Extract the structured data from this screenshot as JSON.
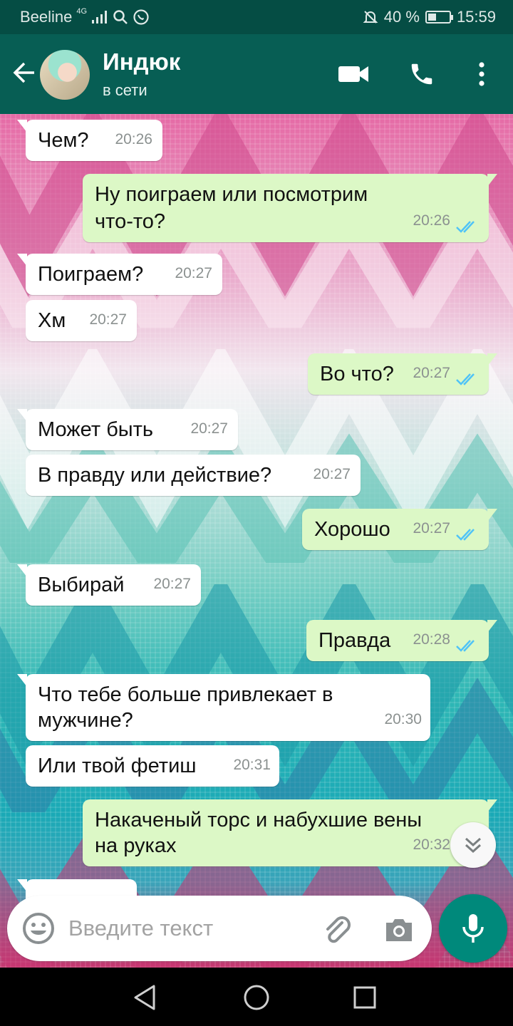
{
  "status_bar": {
    "carrier": "Beeline",
    "network": "4G",
    "battery_percent": "40 %",
    "battery_level": 0.4,
    "time": "15:59"
  },
  "header": {
    "contact_name": "Индюк",
    "contact_status": "в сети",
    "icons": [
      "back-arrow-icon",
      "video-call-icon",
      "phone-icon",
      "more-vertical-icon"
    ]
  },
  "messages": [
    {
      "dir": "in",
      "text": "Чем?",
      "time": "20:26"
    },
    {
      "dir": "out",
      "lines": [
        "Ну поиграем или посмотрим",
        "что-то?"
      ],
      "time": "20:26"
    },
    {
      "dir": "in",
      "text": "Поиграем?",
      "time": "20:27"
    },
    {
      "dir": "in",
      "text": "Хм",
      "time": "20:27"
    },
    {
      "dir": "out",
      "text": "Во что?",
      "time": "20:27"
    },
    {
      "dir": "in",
      "text": "Может быть",
      "time": "20:27"
    },
    {
      "dir": "in",
      "text": "В правду или действие?",
      "time": "20:27"
    },
    {
      "dir": "out",
      "text": "Хорошо",
      "time": "20:27"
    },
    {
      "dir": "in",
      "text": "Выбирай",
      "time": "20:27"
    },
    {
      "dir": "out",
      "text": "Правда",
      "time": "20:28"
    },
    {
      "dir": "in",
      "lines": [
        "Что тебе больше привлекает в",
        "мужчине?"
      ],
      "time": "20:30"
    },
    {
      "dir": "in",
      "text": "Или твой фетиш",
      "time": "20:31"
    },
    {
      "dir": "out",
      "lines": [
        "Накаченый торс и набухшие вены",
        "на руках"
      ],
      "time": "20:32"
    }
  ],
  "input": {
    "placeholder": "Введите текст"
  },
  "colors": {
    "header": "#075e54",
    "status_bar": "#054d44",
    "outgoing_bubble": "#dcf8c6",
    "incoming_bubble": "#ffffff",
    "accent": "#00897b",
    "read_ticks": "#4fc3f7"
  }
}
